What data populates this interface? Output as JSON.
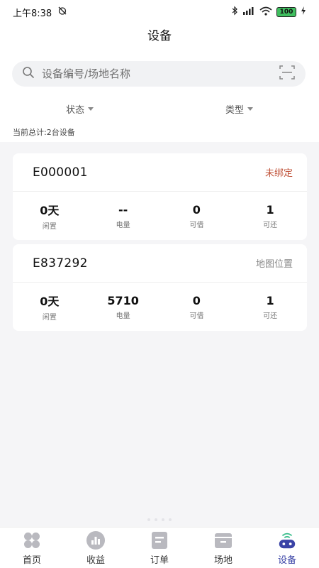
{
  "status_bar": {
    "time": "上午8:38",
    "battery": "100"
  },
  "header": {
    "title": "设备"
  },
  "search": {
    "placeholder": "设备编号/场地名称"
  },
  "filters": [
    {
      "label": "状态"
    },
    {
      "label": "类型"
    }
  ],
  "summary": {
    "total_text": "当前总计:2台设备"
  },
  "devices": [
    {
      "id": "E000001",
      "action": "未绑定",
      "action_color": "#c0533a",
      "stats": [
        {
          "value": "0天",
          "label": "闲置"
        },
        {
          "value": "--",
          "label": "电量"
        },
        {
          "value": "0",
          "label": "可借"
        },
        {
          "value": "1",
          "label": "可还"
        }
      ]
    },
    {
      "id": "E837292",
      "action": "地图位置",
      "action_color": "#888888",
      "stats": [
        {
          "value": "0天",
          "label": "闲置"
        },
        {
          "value": "5710",
          "label": "电量"
        },
        {
          "value": "0",
          "label": "可借"
        },
        {
          "value": "1",
          "label": "可还"
        }
      ]
    }
  ],
  "nav": [
    {
      "label": "首页",
      "icon": "grid-icon"
    },
    {
      "label": "收益",
      "icon": "chart-icon"
    },
    {
      "label": "订单",
      "icon": "order-icon"
    },
    {
      "label": "场地",
      "icon": "venue-icon"
    },
    {
      "label": "设备",
      "icon": "device-icon",
      "active": true
    }
  ],
  "colors": {
    "accent": "#3a43a6",
    "unbound": "#c0533a",
    "muted": "#888888",
    "icon_gray": "#b9b9bf"
  }
}
